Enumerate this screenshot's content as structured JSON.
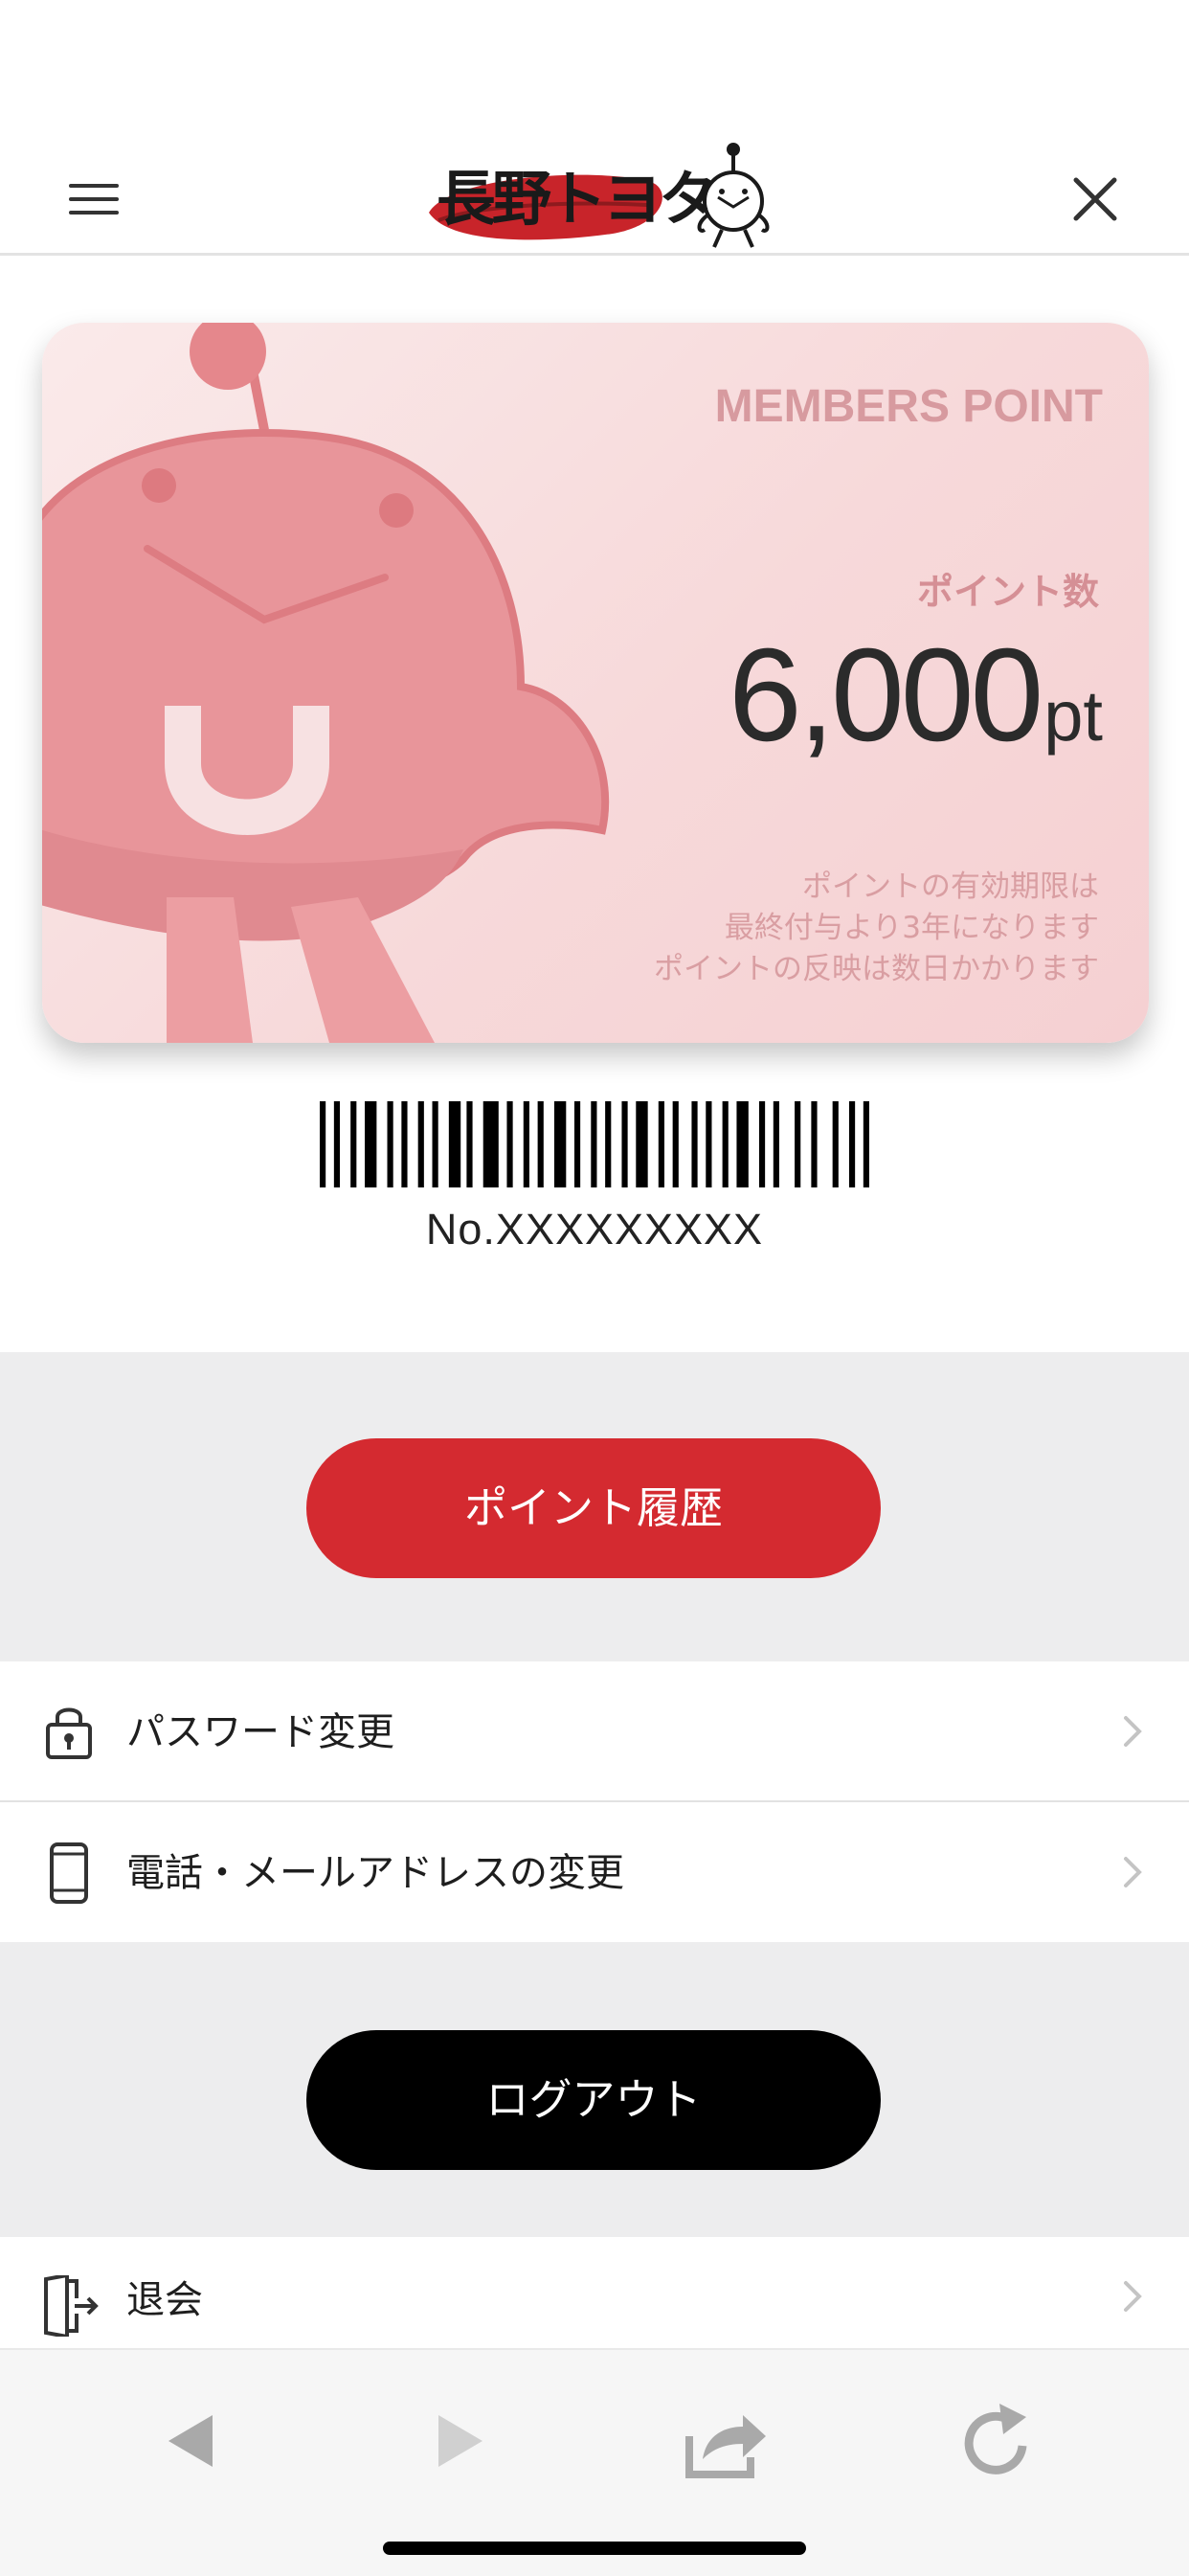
{
  "header": {
    "logo_text": "長野トヨタ",
    "menu_icon": "hamburger-menu-icon",
    "close_icon": "close-icon"
  },
  "card": {
    "title": "MEMBERS POINT",
    "points_label": "ポイント数",
    "points_value": "6,000",
    "points_unit": "pt",
    "notes": [
      "ポイントの有効期限は",
      "最終付与より3年になります",
      "ポイントの反映は数日かかります"
    ]
  },
  "member": {
    "number": "No.XXXXXXXXX"
  },
  "buttons": {
    "history": "ポイント履歴",
    "logout": "ログアウト"
  },
  "menu": {
    "password": {
      "label": "パスワード変更",
      "icon": "lock-icon"
    },
    "contact": {
      "label": "電話・メールアドレスの変更",
      "icon": "smartphone-icon"
    },
    "withdraw": {
      "label": "退会",
      "icon": "exit-door-icon"
    }
  },
  "toolbar": {
    "back_icon": "back-arrow-icon",
    "forward_icon": "forward-arrow-icon",
    "share_icon": "share-icon",
    "reload_icon": "reload-icon"
  },
  "colors": {
    "accent_red": "#d42a30",
    "card_pink": "#f7d9da",
    "band_gray": "#ededee"
  }
}
